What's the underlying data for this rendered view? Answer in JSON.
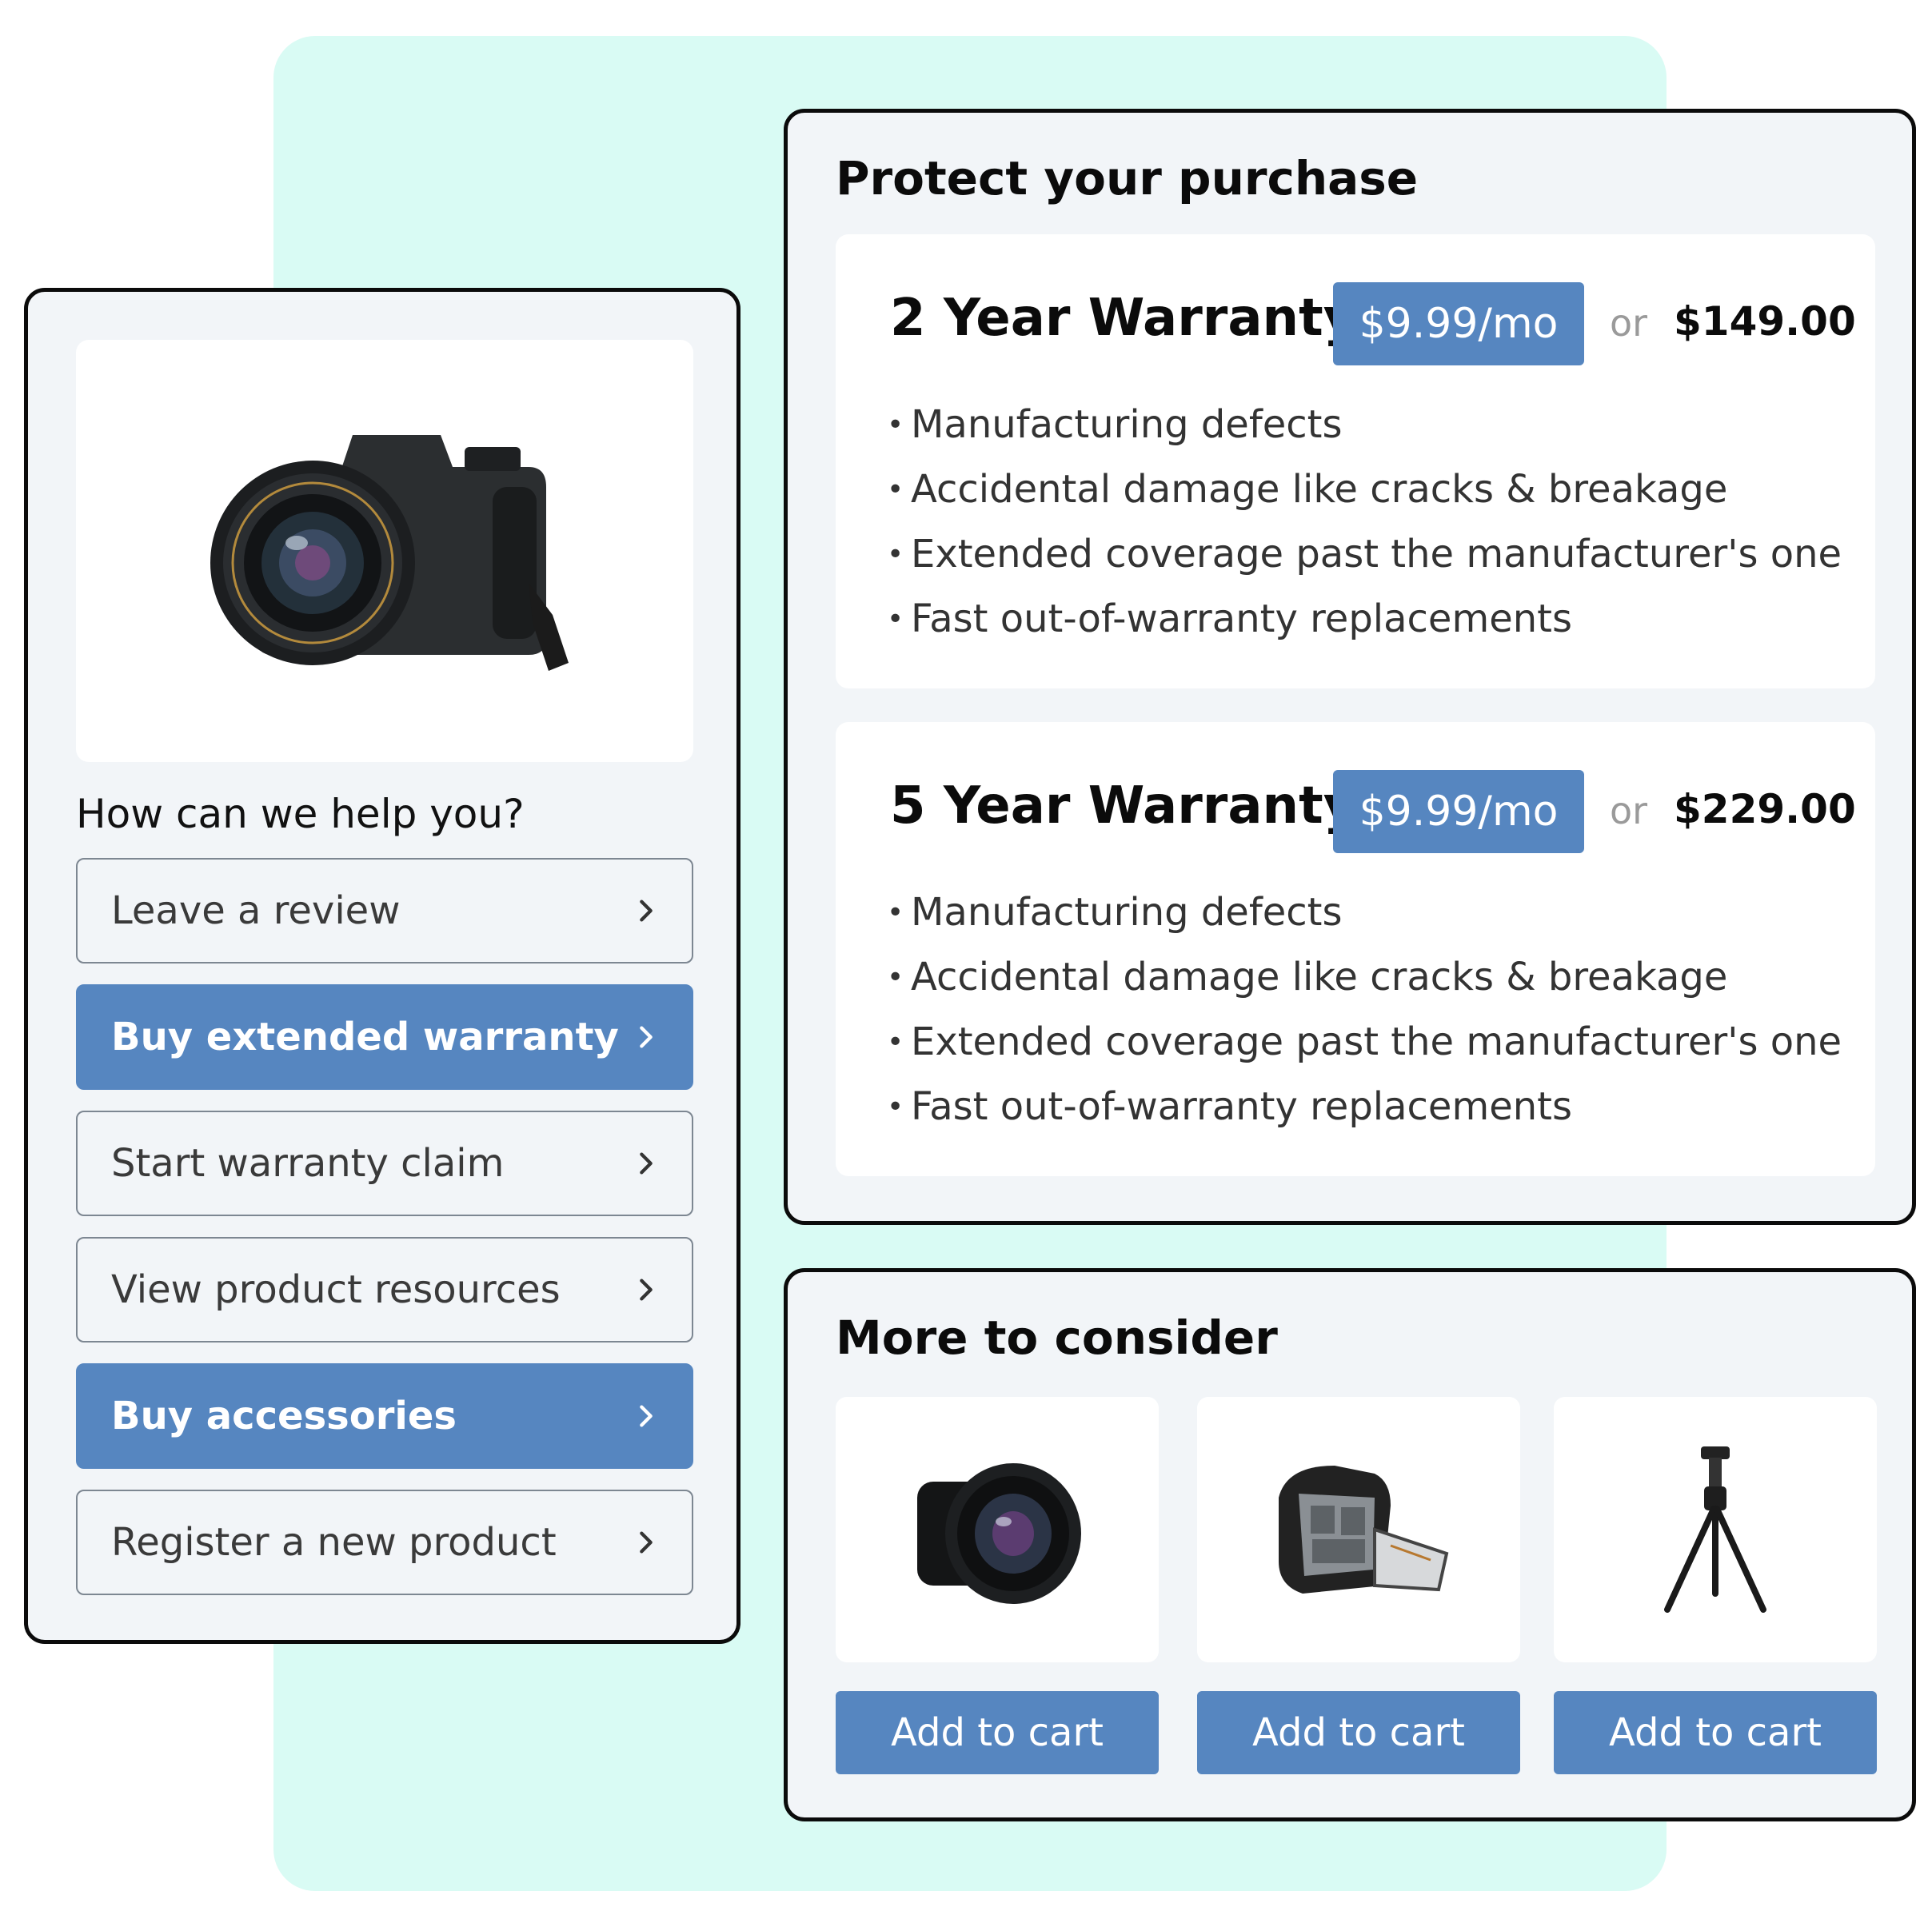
{
  "help": {
    "heading": "How can we help you?",
    "product_image": "camera",
    "options": [
      {
        "label": "Leave a review",
        "primary": false
      },
      {
        "label": "Buy extended warranty",
        "primary": true
      },
      {
        "label": "Start warranty claim",
        "primary": false
      },
      {
        "label": "View product resources",
        "primary": false
      },
      {
        "label": "Buy accessories",
        "primary": true
      },
      {
        "label": "Register a new product",
        "primary": false
      }
    ]
  },
  "warranty": {
    "title": "Protect your purchase",
    "plans": [
      {
        "name": "2 Year Warranty",
        "monthly": "$9.99/mo",
        "or": "or",
        "price": "$149.00",
        "features": [
          "Manufacturing defects",
          "Accidental damage like cracks & breakage",
          "Extended coverage past the manufacturer's one",
          "Fast out-of-warranty replacements"
        ]
      },
      {
        "name": "5 Year Warranty",
        "monthly": "$9.99/mo",
        "or": "or",
        "price": "$229.00",
        "features": [
          "Manufacturing defects",
          "Accidental damage like cracks & breakage",
          "Extended coverage past the manufacturer's one",
          "Fast out-of-warranty replacements"
        ]
      }
    ]
  },
  "more": {
    "title": "More to consider",
    "products": [
      {
        "image": "camera-lens",
        "button": "Add to cart"
      },
      {
        "image": "camera-backpack",
        "button": "Add to cart"
      },
      {
        "image": "tripod",
        "button": "Add to cart"
      }
    ]
  },
  "colors": {
    "accent": "#5686c0",
    "backdrop": "#d9fbf4",
    "card": "#f2f5f8"
  }
}
